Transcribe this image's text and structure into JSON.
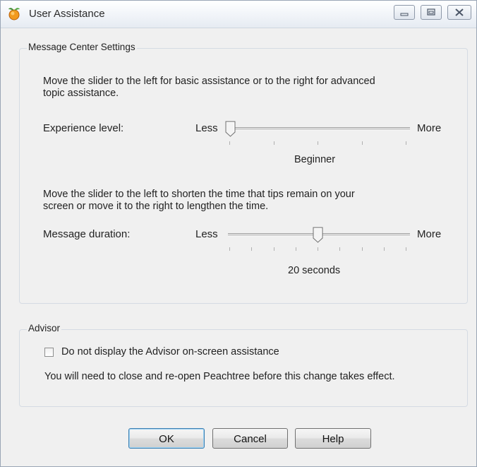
{
  "window": {
    "title": "User Assistance",
    "controls": [
      "minimize-icon",
      "restore-icon",
      "close-icon"
    ]
  },
  "message_center": {
    "legend": "Message Center Settings",
    "experience": {
      "description_line1": "Move the slider to the left for basic assistance or to the right for advanced",
      "description_line2": "topic assistance.",
      "label": "Experience level:",
      "less": "Less",
      "more": "More",
      "value_text": "Beginner",
      "slider_position": 0.0,
      "tick_count": 5
    },
    "duration": {
      "description_line1": "Move the slider to the left to shorten the time that tips remain on your",
      "description_line2": "screen or move it to the right to lengthen the time.",
      "label": "Message duration:",
      "less": "Less",
      "more": "More",
      "value_text": "20 seconds",
      "slider_position": 0.5,
      "tick_count": 9
    }
  },
  "advisor": {
    "legend": "Advisor",
    "checkbox_label": "Do not display the Advisor on-screen assistance",
    "checked": false,
    "note": "You will need to close and re-open Peachtree before this change takes effect."
  },
  "buttons": {
    "ok": "OK",
    "cancel": "Cancel",
    "help": "Help"
  },
  "colors": {
    "window_bg": "#f0f0f0",
    "default_button_border": "#3c7fb1"
  }
}
